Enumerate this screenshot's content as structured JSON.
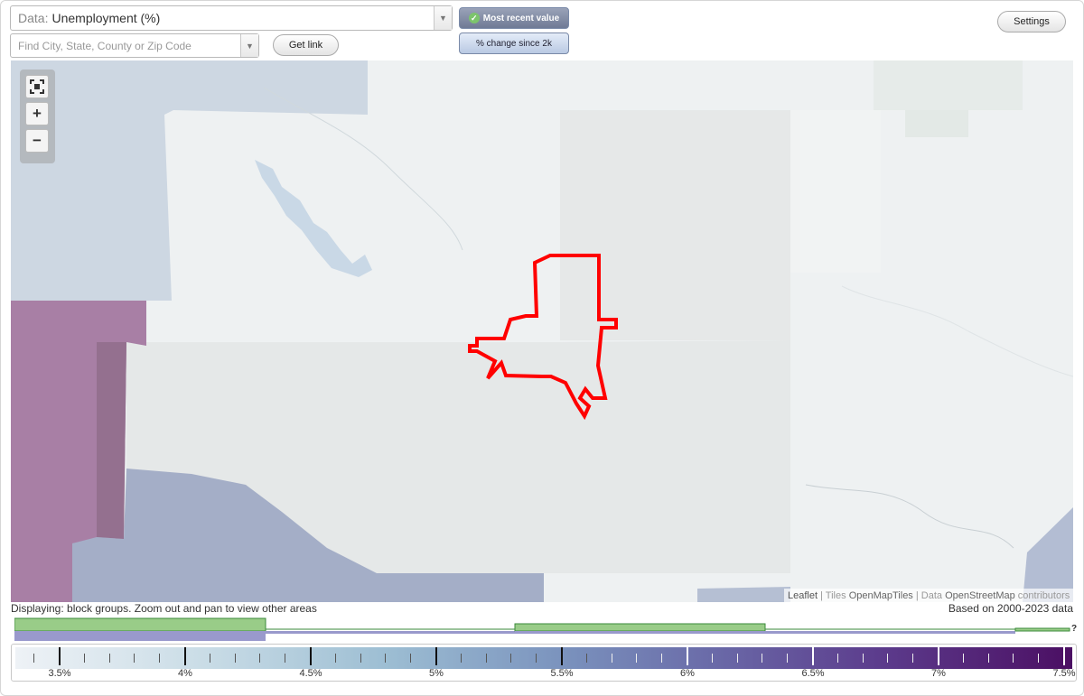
{
  "data_selector": {
    "prefix": "Data:",
    "value": "Unemployment (%)",
    "arrow": "▼"
  },
  "search": {
    "placeholder": "Find City, State, County or Zip Code",
    "arrow": "▼"
  },
  "buttons": {
    "get_link": "Get link",
    "settings": "Settings",
    "most_recent": "Most recent value",
    "pct_change": "% change since 2k"
  },
  "zoom": {
    "fullscreen_icon": "fullscreen-icon",
    "zoom_in": "+",
    "zoom_out": "−"
  },
  "attribution": {
    "leaflet": "Leaflet",
    "sep1": " | Tiles ",
    "tiles": "OpenMapTiles",
    "sep2": " | Data ",
    "data": "OpenStreetMap",
    "contributors": " contributors"
  },
  "status": {
    "left": "Displaying: block groups. Zoom out and pan to view other areas",
    "right": "Based on 2000-2023 data"
  },
  "histogram": {
    "unknown_marker": "?"
  },
  "legend": {
    "labels": [
      "3.5%",
      "4%",
      "4.5%",
      "5%",
      "5.5%",
      "6%",
      "6.5%",
      "7%",
      "7.5%"
    ],
    "colors": {
      "low": "#eef2f6",
      "mid": "#7a92bd",
      "high": "#4b0f63"
    }
  },
  "colors": {
    "highlight_outline": "#ff0000",
    "region_purple": "#a87fa5",
    "region_bluegray": "#a4aec7",
    "hist_green": "#99cc88",
    "hist_purple": "#9999cc"
  }
}
